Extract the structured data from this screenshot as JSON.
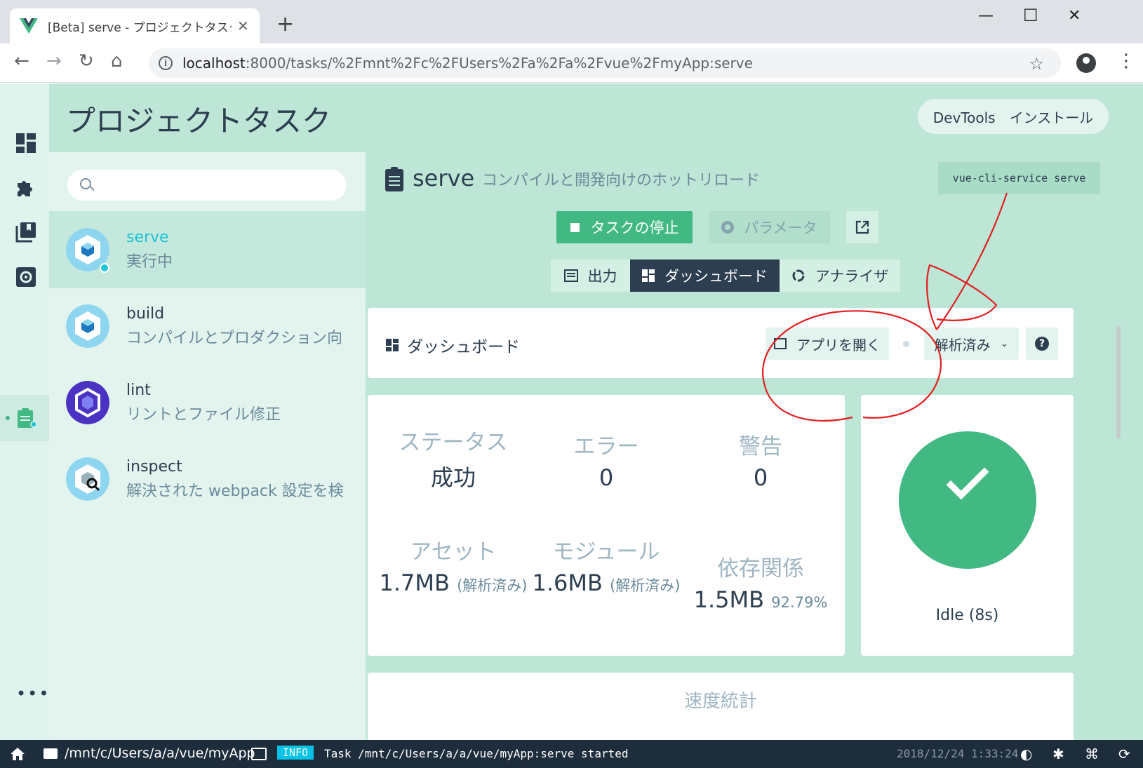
{
  "browser": {
    "tab_title": "[Beta] serve - プロジェクトタスク - Vue CLI",
    "url_host": "localhost",
    "url_path": ":8000/tasks/%2Fmnt%2Fc%2FUsers%2Fa%2Fa%2Fvue%2FmyApp:serve"
  },
  "header": {
    "title": "プロジェクトタスク",
    "devtools_label": "DevTools　インストール"
  },
  "sidebar": {
    "search_placeholder": "",
    "tasks": [
      {
        "name": "serve",
        "desc": "実行中"
      },
      {
        "name": "build",
        "desc": "コンパイルとプロダクション向けの縮小"
      },
      {
        "name": "lint",
        "desc": "リントとファイル修正"
      },
      {
        "name": "inspect",
        "desc": "解決された webpack 設定を検査"
      }
    ]
  },
  "task": {
    "name": "serve",
    "desc": "コンパイルと開発向けのホットリロード",
    "command": "vue-cli-service serve",
    "stop_label": "タスクの停止",
    "params_label": "パラメータ"
  },
  "views": {
    "output": "出力",
    "dashboard": "ダッシュボード",
    "analyzer": "アナライザ"
  },
  "dashboard": {
    "title": "ダッシュボード",
    "open_app": "アプリを開く",
    "analysis_mode": "解析済み",
    "help": "?"
  },
  "stats": {
    "status_label": "ステータス",
    "status_value": "成功",
    "errors_label": "エラー",
    "errors_value": "0",
    "warnings_label": "警告",
    "warnings_value": "0",
    "assets_label": "アセット",
    "assets_value": "1.7MB",
    "assets_note": "(解析済み)",
    "modules_label": "モジュール",
    "modules_value": "1.6MB",
    "modules_note": "(解析済み)",
    "deps_label": "依存関係",
    "deps_value": "1.5MB",
    "deps_note": "92.79%"
  },
  "status_widget": {
    "text": "Idle (8s)"
  },
  "bottom_card": {
    "title": "速度統計"
  },
  "statusbar": {
    "path": "/mnt/c/Users/a/a/vue/myApp",
    "level": "INFO",
    "log": "Task /mnt/c/Users/a/a/vue/myApp:serve started",
    "time": "2018/12/24 1:33:24"
  },
  "colors": {
    "accent": "#42b983",
    "dark": "#2c3e50",
    "bg": "#bde6d6",
    "annotation": "#e02020"
  }
}
